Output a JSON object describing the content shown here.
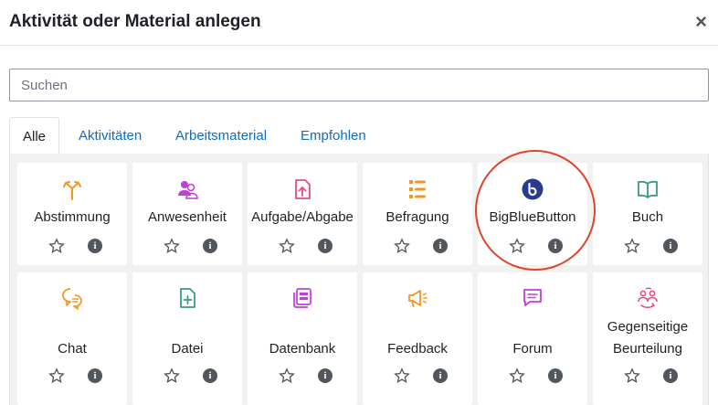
{
  "modal": {
    "title": "Aktivität oder Material anlegen",
    "close": "×"
  },
  "search": {
    "placeholder": "Suchen"
  },
  "tabs": [
    {
      "label": "Alle",
      "active": true
    },
    {
      "label": "Aktivitäten",
      "active": false
    },
    {
      "label": "Arbeitsmaterial",
      "active": false
    },
    {
      "label": "Empfohlen",
      "active": false
    }
  ],
  "info_glyph": "i",
  "colors": {
    "link": "#0f6cbf",
    "orange": "#f7941d",
    "purple": "#c13edb",
    "pink": "#e74b84",
    "green": "#399b7f",
    "blue_dark": "#2a3a8f",
    "highlight": "#e0422a"
  },
  "activities": [
    {
      "name": "Abstimmung",
      "icon": "choice-icon"
    },
    {
      "name": "Anwesenheit",
      "icon": "attendance-icon"
    },
    {
      "name": "Aufgabe/Abgabe",
      "icon": "assignment-icon"
    },
    {
      "name": "Befragung",
      "icon": "feedback-list-icon"
    },
    {
      "name": "BigBlueButton",
      "icon": "bigbluebutton-icon"
    },
    {
      "name": "Buch",
      "icon": "book-icon"
    },
    {
      "name": "Chat",
      "icon": "chat-icon"
    },
    {
      "name": "Datei",
      "icon": "file-icon"
    },
    {
      "name": "Datenbank",
      "icon": "database-icon"
    },
    {
      "name": "Feedback",
      "icon": "megaphone-icon"
    },
    {
      "name": "Forum",
      "icon": "forum-icon"
    },
    {
      "name": "Gegenseitige Beurteilung",
      "name_line1": "Gegenseitige",
      "name_line2": "Beurteilung",
      "icon": "workshop-icon"
    }
  ]
}
